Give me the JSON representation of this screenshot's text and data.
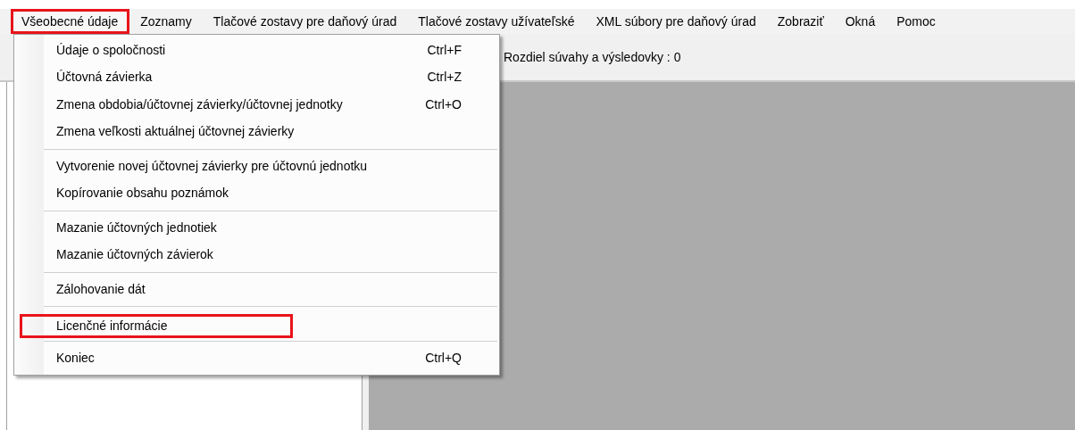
{
  "menu_bar": [
    {
      "label": "Všeobecné údaje",
      "open": true,
      "highlighted": true
    },
    {
      "label": "Zoznamy",
      "open": false,
      "highlighted": false
    },
    {
      "label": "Tlačové zostavy pre daňový úrad",
      "open": false,
      "highlighted": false
    },
    {
      "label": "Tlačové zostavy užívateľské",
      "open": false,
      "highlighted": false
    },
    {
      "label": "XML súbory pre daňový úrad",
      "open": false,
      "highlighted": false
    },
    {
      "label": "Zobraziť",
      "open": false,
      "highlighted": false
    },
    {
      "label": "Okná",
      "open": false,
      "highlighted": false
    },
    {
      "label": "Pomoc",
      "open": false,
      "highlighted": false
    }
  ],
  "toolbar": {
    "status_text": "Rozdiel súvahy a výsledovky : 0"
  },
  "dropdown": [
    {
      "kind": "item",
      "label": "Údaje o spoločnosti",
      "shortcut": "Ctrl+F",
      "highlighted": false
    },
    {
      "kind": "item",
      "label": "Účtovná závierka",
      "shortcut": "Ctrl+Z",
      "highlighted": false
    },
    {
      "kind": "item",
      "label": "Zmena obdobia/účtovnej závierky/účtovnej jednotky",
      "shortcut": "Ctrl+O",
      "highlighted": false
    },
    {
      "kind": "item",
      "label": "Zmena veľkosti aktuálnej účtovnej závierky",
      "highlighted": false
    },
    {
      "kind": "separator"
    },
    {
      "kind": "item",
      "label": "Vytvorenie novej účtovnej závierky pre účtovnú jednotku",
      "highlighted": false
    },
    {
      "kind": "item",
      "label": "Kopírovanie obsahu poznámok",
      "highlighted": false
    },
    {
      "kind": "separator"
    },
    {
      "kind": "item",
      "label": "Mazanie účtovných jednotiek",
      "highlighted": false
    },
    {
      "kind": "item",
      "label": "Mazanie účtovných závierok",
      "highlighted": false
    },
    {
      "kind": "separator"
    },
    {
      "kind": "item",
      "label": "Zálohovanie dát",
      "highlighted": false
    },
    {
      "kind": "separator"
    },
    {
      "kind": "item",
      "label": "Licenčné informácie",
      "highlighted": true
    },
    {
      "kind": "separator"
    },
    {
      "kind": "item",
      "label": "Koniec",
      "shortcut": "Ctrl+Q",
      "highlighted": false
    }
  ]
}
